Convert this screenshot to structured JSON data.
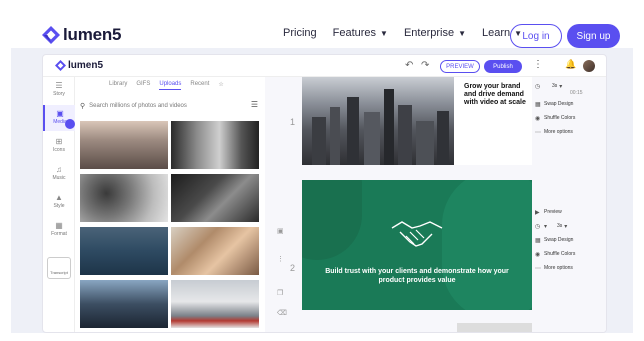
{
  "site": {
    "brand": "lumen5",
    "nav": [
      {
        "label": "Pricing",
        "dropdown": false
      },
      {
        "label": "Features",
        "dropdown": true
      },
      {
        "label": "Enterprise",
        "dropdown": true
      },
      {
        "label": "Learn",
        "dropdown": true
      }
    ],
    "login_label": "Log in",
    "signup_label": "Sign up",
    "accent": "#5a4ff0"
  },
  "app": {
    "brand": "lumen5",
    "preview_label": "PREVIEW",
    "publish_label": "Publish",
    "rail": [
      {
        "label": "Story",
        "icon": "list-icon"
      },
      {
        "label": "Media",
        "icon": "image-icon",
        "active": true
      },
      {
        "label": "Icons",
        "icon": "grid-icon"
      },
      {
        "label": "Music",
        "icon": "music-icon"
      },
      {
        "label": "Style",
        "icon": "paint-icon"
      },
      {
        "label": "Format",
        "icon": "format-icon"
      }
    ],
    "transcript_label": "Transcript",
    "tabs": [
      "Library",
      "GIFS",
      "Uploads",
      "Recent"
    ],
    "active_tab": "Uploads",
    "search_placeholder": "Search millions of photos and videos",
    "scenes": [
      {
        "number": "1",
        "text": "Grow your brand and drive demand with video at scale"
      },
      {
        "number": "2",
        "text": "Build trust with your clients and demonstrate how your product provides value"
      }
    ],
    "scene1_opts": {
      "duration": "3s",
      "timer": "00:15",
      "items": [
        "Swap Design",
        "Shuffle Colors",
        "More options"
      ]
    },
    "scene2_opts": {
      "preview": "Preview",
      "duration": "3s",
      "items": [
        "Swap Design",
        "Shuffle Colors",
        "More options"
      ]
    },
    "green": "#1a7a57"
  }
}
